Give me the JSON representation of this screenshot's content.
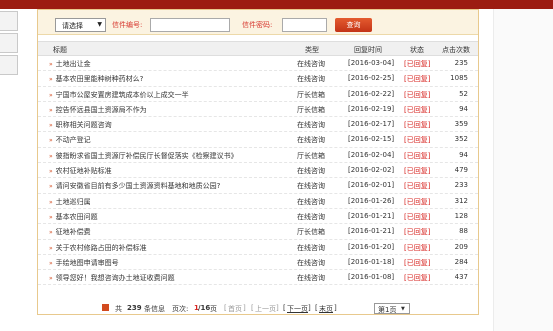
{
  "search": {
    "select_value": "请选择",
    "number_label": "信件编号:",
    "password_label": "信件密码:",
    "query_button": "查询"
  },
  "table": {
    "headers": {
      "title": "标题",
      "type": "类型",
      "date": "回复时间",
      "status": "状态",
      "count": "点击次数"
    },
    "rows": [
      {
        "title": "土地出让金",
        "type": "在线咨询",
        "date": "[2016-03-04]",
        "status": "[已回复]",
        "count": "235"
      },
      {
        "title": "基本农田里能种树种药材么?",
        "type": "在线咨询",
        "date": "[2016-02-25]",
        "status": "[已回复]",
        "count": "1085"
      },
      {
        "title": "宁国市公屋安置房建筑成本价以上成交一半",
        "type": "厅长信箱",
        "date": "[2016-02-22]",
        "status": "[已回复]",
        "count": "52"
      },
      {
        "title": "控告怀远县国土资源局不作为",
        "type": "厅长信箱",
        "date": "[2016-02-19]",
        "status": "[已回复]",
        "count": "94"
      },
      {
        "title": "职称相关问题咨询",
        "type": "在线咨询",
        "date": "[2016-02-17]",
        "status": "[已回复]",
        "count": "359"
      },
      {
        "title": "不动产登记",
        "type": "在线咨询",
        "date": "[2016-02-15]",
        "status": "[已回复]",
        "count": "352"
      },
      {
        "title": "彼指盼求省国土资源厅补偿民厅长督促落实《检察建议书》",
        "type": "厅长信箱",
        "date": "[2016-02-04]",
        "status": "[已回复]",
        "count": "94"
      },
      {
        "title": "农村征地补贴标准",
        "type": "在线咨询",
        "date": "[2016-02-02]",
        "status": "[已回复]",
        "count": "479"
      },
      {
        "title": "请问安徽省目前有多少国土资源资料基地和地质公园?",
        "type": "在线咨询",
        "date": "[2016-02-01]",
        "status": "[已回复]",
        "count": "233"
      },
      {
        "title": "土地巡归属",
        "type": "在线咨询",
        "date": "[2016-01-26]",
        "status": "[已回复]",
        "count": "312"
      },
      {
        "title": "基本农田问题",
        "type": "在线咨询",
        "date": "[2016-01-21]",
        "status": "[已回复]",
        "count": "128"
      },
      {
        "title": "征地补偿费",
        "type": "厅长信箱",
        "date": "[2016-01-21]",
        "status": "[已回复]",
        "count": "88"
      },
      {
        "title": "关于农村修路占田的补偿标准",
        "type": "在线咨询",
        "date": "[2016-01-20]",
        "status": "[已回复]",
        "count": "209"
      },
      {
        "title": "手绘地图申请审图号",
        "type": "在线咨询",
        "date": "[2016-01-18]",
        "status": "[已回复]",
        "count": "284"
      },
      {
        "title": "领导您好！我想咨询办土地证收费问题",
        "type": "在线咨询",
        "date": "[2016-01-08]",
        "status": "[已回复]",
        "count": "437"
      }
    ]
  },
  "pager": {
    "total_prefix": "共",
    "total": "239",
    "total_suffix": "条信息",
    "page_label": "页次:",
    "page_current": "1",
    "page_total": "/16",
    "page_unit": "页",
    "first": "首页",
    "prev": "上一页",
    "next": "下一页",
    "last": "末页",
    "select_value": "第1页"
  }
}
